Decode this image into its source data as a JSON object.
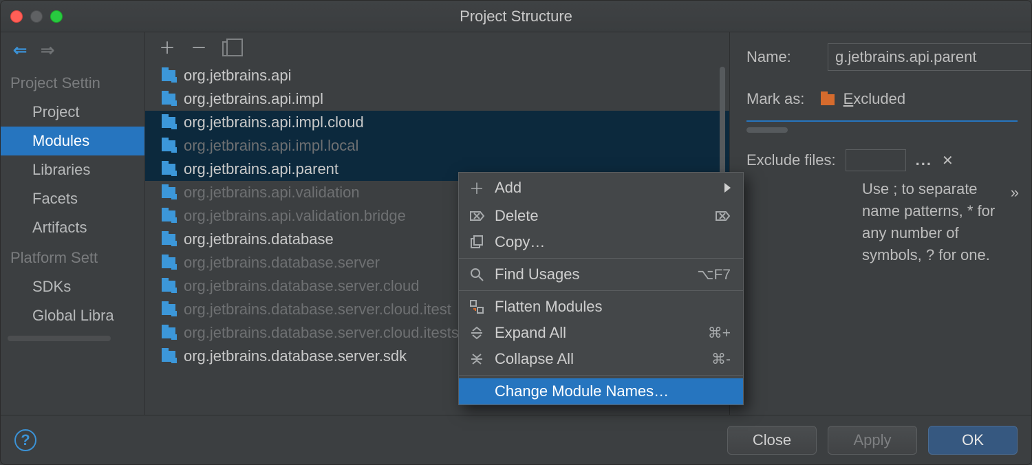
{
  "window": {
    "title": "Project Structure"
  },
  "sidebar": {
    "groups": [
      {
        "label": "Project Settin"
      },
      {
        "label": "Platform Sett"
      }
    ],
    "items1": [
      {
        "label": "Project"
      },
      {
        "label": "Modules"
      },
      {
        "label": "Libraries"
      },
      {
        "label": "Facets"
      },
      {
        "label": "Artifacts"
      }
    ],
    "items2": [
      {
        "label": "SDKs"
      },
      {
        "label": "Global Libra"
      }
    ]
  },
  "modules": {
    "items": [
      {
        "label": "org.jetbrains.api"
      },
      {
        "label": "org.jetbrains.api.impl"
      },
      {
        "label": "org.jetbrains.api.impl.cloud"
      },
      {
        "label": "org.jetbrains.api.impl.local"
      },
      {
        "label": "org.jetbrains.api.parent"
      },
      {
        "label": "org.jetbrains.api.validation"
      },
      {
        "label": "org.jetbrains.api.validation.bridge"
      },
      {
        "label": "org.jetbrains.database"
      },
      {
        "label": "org.jetbrains.database.server"
      },
      {
        "label": "org.jetbrains.database.server.cloud"
      },
      {
        "label": "org.jetbrains.database.server.cloud.itest"
      },
      {
        "label": "org.jetbrains.database.server.cloud.itests"
      },
      {
        "label": "org.jetbrains.database.server.sdk"
      }
    ]
  },
  "context_menu": {
    "add": "Add",
    "delete": "Delete",
    "copy": "Copy…",
    "find_usages": "Find Usages",
    "find_usages_shortcut": "⌥F7",
    "flatten": "Flatten Modules",
    "expand": "Expand All",
    "expand_shortcut": "⌘+",
    "collapse": "Collapse All",
    "collapse_shortcut": "⌘-",
    "change_names": "Change Module Names…"
  },
  "details": {
    "name_label": "Name:",
    "name_value": "g.jetbrains.api.parent",
    "mark_as_label": "Mark as:",
    "excluded_label": "Excluded",
    "more": "»",
    "exclude_files_label": "Exclude files:",
    "dots": "...",
    "hint": "Use ; to separate name patterns, * for any number of symbols, ? for one."
  },
  "footer": {
    "close": "Close",
    "apply": "Apply",
    "ok": "OK"
  }
}
